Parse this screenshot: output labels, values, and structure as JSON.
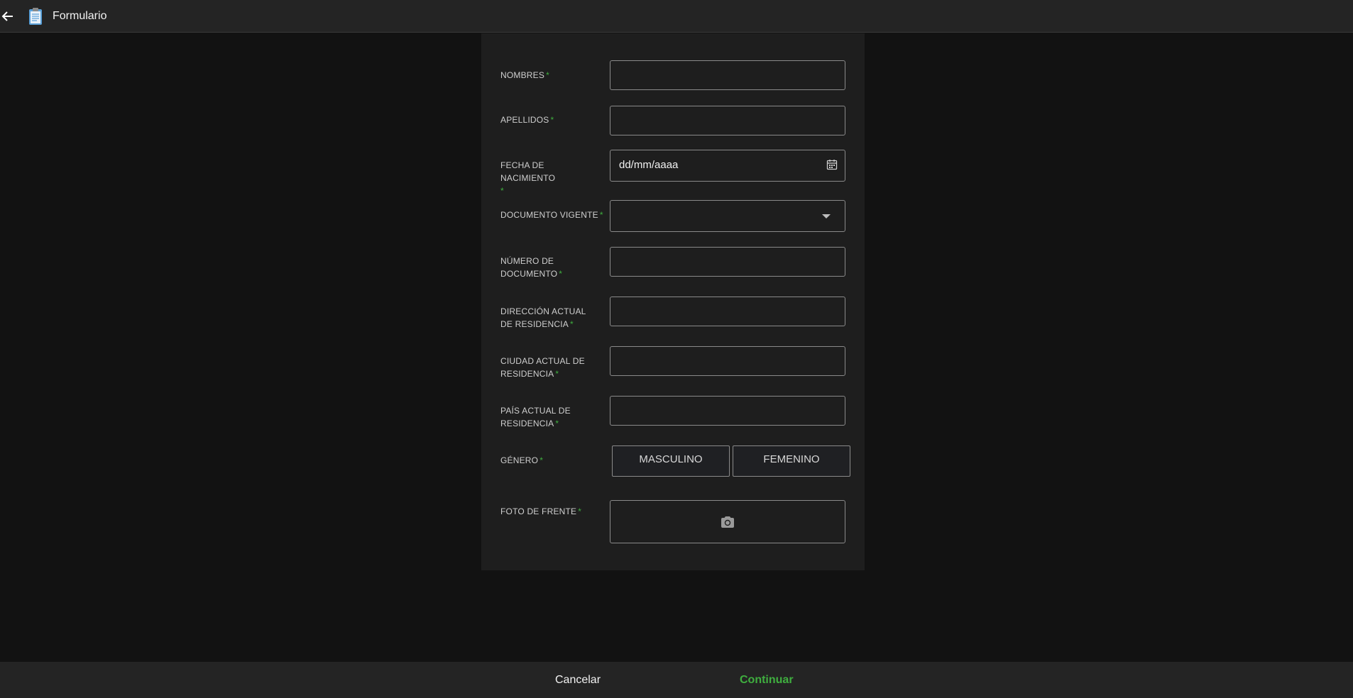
{
  "header": {
    "title": "Formulario",
    "back_icon": "arrow-left-icon",
    "app_icon": "clipboard-icon"
  },
  "form": {
    "required_mark": "*",
    "nombres_label": "NOMBRES",
    "apellidos_label": "APELLIDOS",
    "fecha_label": "FECHA DE NACIMIENTO",
    "fecha_placeholder": "dd/mm/aaaa",
    "documento_vigente_label": "DOCUMENTO VIGENTE",
    "numero_documento_label": "NÚMERO DE DOCUMENTO",
    "direccion_label": "DIRECCIÓN ACTUAL DE RESIDENCIA",
    "ciudad_label": "CIUDAD ACTUAL DE RESIDENCIA",
    "pais_label": "PAÍS ACTUAL DE RESIDENCIA",
    "genero_label": "GÉNERO",
    "genero_options": [
      "MASCULINO",
      "FEMENINO"
    ],
    "foto_label": "FOTO DE FRENTE",
    "foto_icon": "camera-icon"
  },
  "footer": {
    "cancel_label": "Cancelar",
    "continue_label": "Continuar"
  },
  "colors": {
    "accent": "#3fae3f",
    "background": "#121212",
    "panel": "#1e1e1e",
    "bar": "#242424"
  }
}
